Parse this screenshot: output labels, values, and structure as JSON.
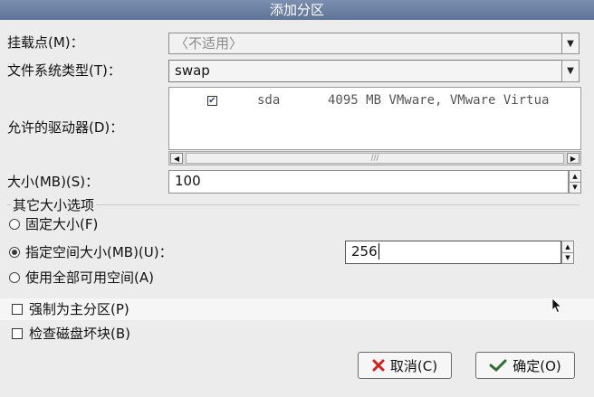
{
  "window": {
    "title": "添加分区"
  },
  "mount_point": {
    "label": "挂载点(M)：",
    "value": "〈不适用〉"
  },
  "fs_type": {
    "label": "文件系统类型(T)：",
    "value": "swap"
  },
  "drives": {
    "label": "允许的驱动器(D)：",
    "rows": [
      {
        "checked": true,
        "name": "sda",
        "info": "4095 MB VMware, VMware Virtua"
      }
    ]
  },
  "size": {
    "label": "大小(MB)(S)：",
    "value": "100"
  },
  "other_size": {
    "legend": "其它大小选项",
    "options": [
      {
        "label": "固定大小(F)",
        "selected": false
      },
      {
        "label": "指定空间大小(MB)(U)：",
        "selected": true
      },
      {
        "label": "使用全部可用空间(A)",
        "selected": false
      }
    ],
    "max_value": "256"
  },
  "force_primary": {
    "label": "强制为主分区(P)",
    "checked": false
  },
  "check_bad_blocks": {
    "label": "检查磁盘坏块(B)",
    "checked": false
  },
  "buttons": {
    "cancel": "取消(C)",
    "ok": "确定(O)"
  },
  "icons": {
    "cancel": "close-x-icon",
    "ok": "ok-check-icon",
    "cursor": "mouse-pointer-icon"
  },
  "colors": {
    "title_bar": "#6a7fa3",
    "cancel_icon": "#d21f1f"
  }
}
